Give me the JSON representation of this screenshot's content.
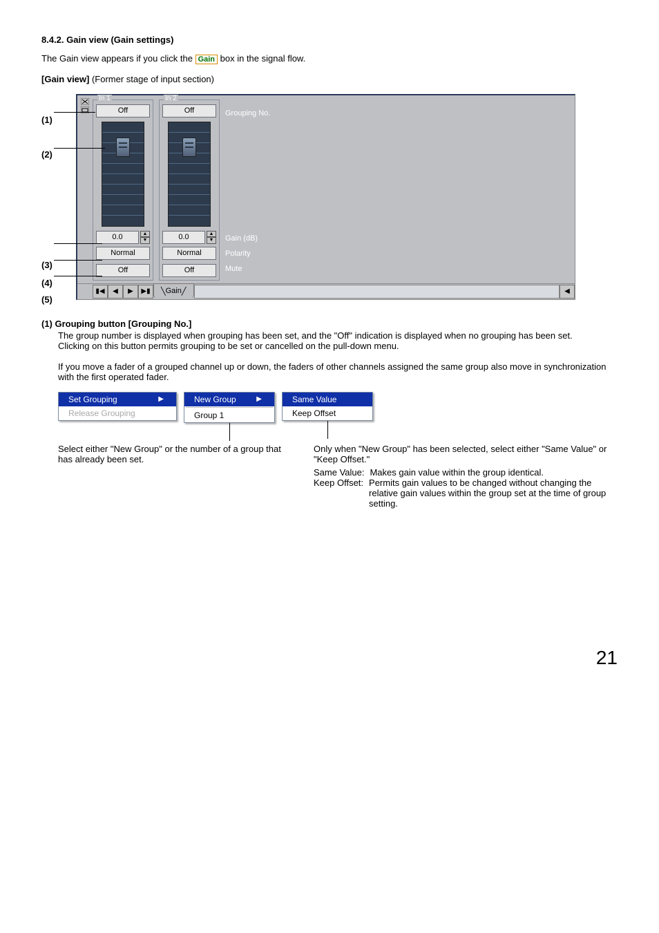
{
  "heading": "8.4.2. Gain view (Gain settings)",
  "intro_before": "The Gain view appears if you click the ",
  "intro_after": " box in the signal flow.",
  "gain_box_label": "Gain",
  "subhead_before": "[Gain view]",
  "subhead_after": " (Former stage of input section)",
  "callouts": [
    "(1)",
    "(2)",
    "(3)",
    "(4)",
    "(5)"
  ],
  "view": {
    "ch1_legend": "In 1",
    "ch2_legend": "In 2",
    "grouping_value": "Off",
    "gain_value": "0.0",
    "polarity_value": "Normal",
    "mute_value": "Off",
    "label_grouping": "Grouping No.",
    "label_gain": "Gain (dB)",
    "label_polarity": "Polarity",
    "label_mute": "Mute",
    "tab_label": "Gain"
  },
  "item1": {
    "title": "(1) Grouping button [Grouping No.]",
    "p1": "The group number is displayed when grouping has been set, and the \"Off\" indication is displayed when no grouping has been set.",
    "p2": "Clicking on this button permits grouping to be set or cancelled on the pull-down menu.",
    "p3": "If you move a fader of a grouped channel up or down, the faders of other channels assigned the same group also move in synchronization with the first operated fader."
  },
  "menus": {
    "set_grouping": "Set Grouping",
    "release_grouping": "Release Grouping",
    "new_group": "New Group",
    "group1": "Group 1",
    "same_value": "Same Value",
    "keep_offset": "Keep Offset"
  },
  "notes": {
    "left": "Select either \"New Group\" or the number of a group that has already been set.",
    "right_intro": "Only when \"New Group\" has been selected, select either \"Same Value\" or \"Keep Offset.\"",
    "same_value_label": "Same Value:",
    "same_value_text": "Makes gain value within the group identical.",
    "keep_offset_label": "Keep Offset:",
    "keep_offset_text": "Permits gain values to be changed without changing the relative gain values within the group set at the time of group setting."
  },
  "page_number": "21"
}
